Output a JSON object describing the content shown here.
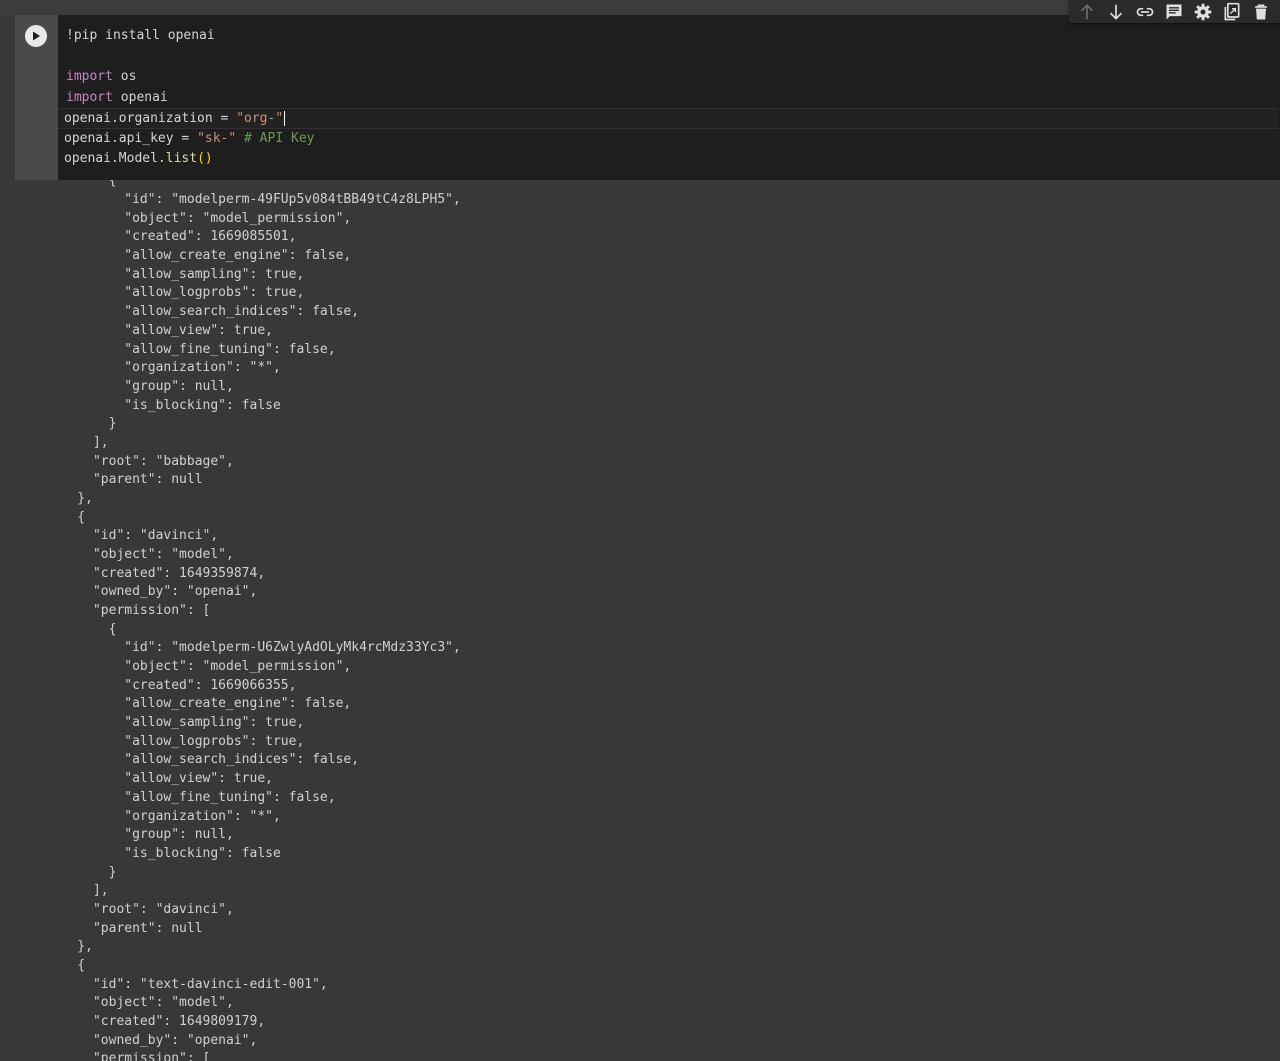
{
  "toolbar": {
    "buttons": [
      {
        "name": "move-cell-up-icon"
      },
      {
        "name": "move-cell-down-icon"
      },
      {
        "name": "link-icon"
      },
      {
        "name": "comment-icon"
      },
      {
        "name": "settings-gear-icon"
      },
      {
        "name": "mirror-cell-icon"
      },
      {
        "name": "delete-trash-icon"
      }
    ]
  },
  "cell": {
    "lines": {
      "l1": "!pip install openai",
      "l3_kw": "import",
      "l3_rest": " os",
      "l4_kw": "import",
      "l4_rest": " openai",
      "l5_pre": "openai.organization = ",
      "l5_str": "\"org-\"",
      "l6_pre": "openai.api_key = ",
      "l6_str": "\"sk-\"",
      "l6_cmt": " # API Key",
      "l7_pre": "openai.Model.",
      "l7_fn": "list",
      "l7_paren": "()"
    }
  },
  "output": {
    "lines": [
      "        {",
      "          \"id\": \"modelperm-49FUp5v084tBB49tC4z8LPH5\",",
      "          \"object\": \"model_permission\",",
      "          \"created\": 1669085501,",
      "          \"allow_create_engine\": false,",
      "          \"allow_sampling\": true,",
      "          \"allow_logprobs\": true,",
      "          \"allow_search_indices\": false,",
      "          \"allow_view\": true,",
      "          \"allow_fine_tuning\": false,",
      "          \"organization\": \"*\",",
      "          \"group\": null,",
      "          \"is_blocking\": false",
      "        }",
      "      ],",
      "      \"root\": \"babbage\",",
      "      \"parent\": null",
      "    },",
      "    {",
      "      \"id\": \"davinci\",",
      "      \"object\": \"model\",",
      "      \"created\": 1649359874,",
      "      \"owned_by\": \"openai\",",
      "      \"permission\": [",
      "        {",
      "          \"id\": \"modelperm-U6ZwlyAdOLyMk4rcMdz33Yc3\",",
      "          \"object\": \"model_permission\",",
      "          \"created\": 1669066355,",
      "          \"allow_create_engine\": false,",
      "          \"allow_sampling\": true,",
      "          \"allow_logprobs\": true,",
      "          \"allow_search_indices\": false,",
      "          \"allow_view\": true,",
      "          \"allow_fine_tuning\": false,",
      "          \"organization\": \"*\",",
      "          \"group\": null,",
      "          \"is_blocking\": false",
      "        }",
      "      ],",
      "      \"root\": \"davinci\",",
      "      \"parent\": null",
      "    },",
      "    {",
      "      \"id\": \"text-davinci-edit-001\",",
      "      \"object\": \"model\",",
      "      \"created\": 1649809179,",
      "      \"owned_by\": \"openai\",",
      "      \"permission\": ["
    ]
  }
}
